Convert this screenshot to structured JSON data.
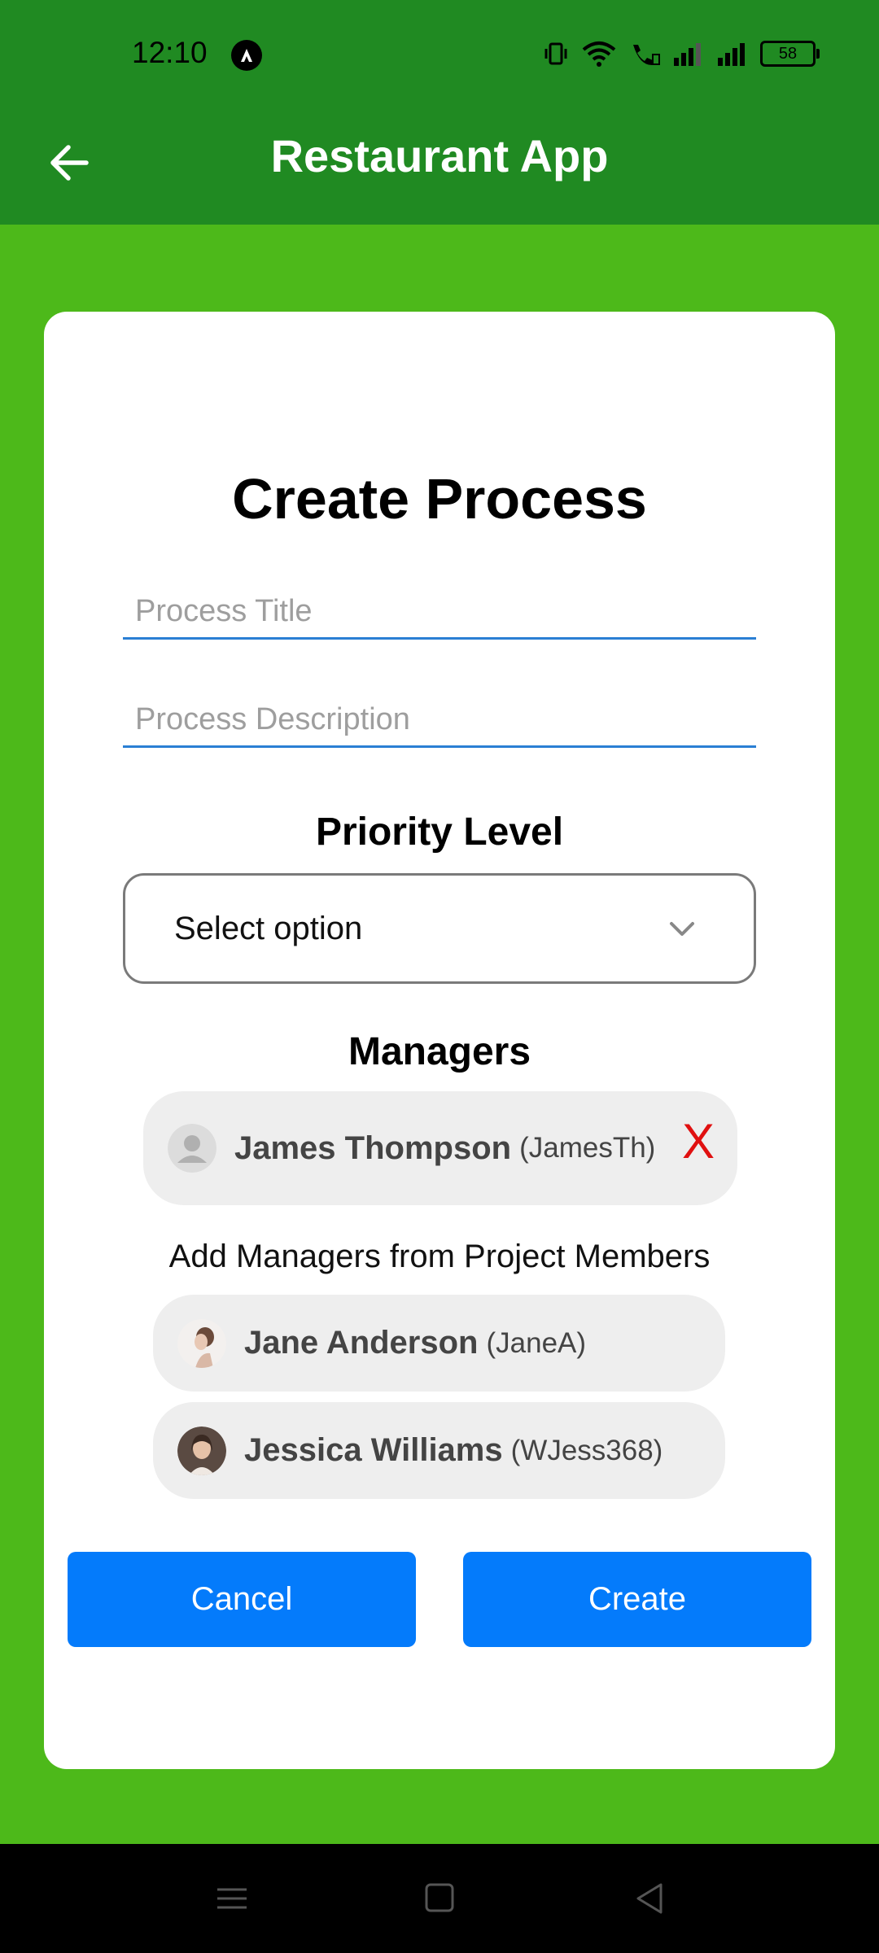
{
  "status_bar": {
    "time": "12:10",
    "battery": "58"
  },
  "app_bar": {
    "title": "Restaurant App"
  },
  "form": {
    "title": "Create Process",
    "title_field": {
      "value": "",
      "placeholder": "Process Title"
    },
    "description_field": {
      "value": "",
      "placeholder": "Process Description"
    },
    "priority_label": "Priority Level",
    "priority_select": {
      "selected": "Select option"
    },
    "managers_label": "Managers",
    "selected_managers": [
      {
        "name": "James Thompson",
        "username": "(JamesTh)",
        "remove_label": "X"
      }
    ],
    "add_managers_hint": "Add Managers from Project Members",
    "project_members": [
      {
        "name": "Jane Anderson",
        "username": "(JaneA)"
      },
      {
        "name": "Jessica Williams",
        "username": "(WJess368)"
      }
    ],
    "cancel_label": "Cancel",
    "create_label": "Create"
  },
  "colors": {
    "app_bar": "#208a22",
    "background": "#4db91a",
    "primary_button": "#047bfb",
    "remove": "#e01010"
  }
}
